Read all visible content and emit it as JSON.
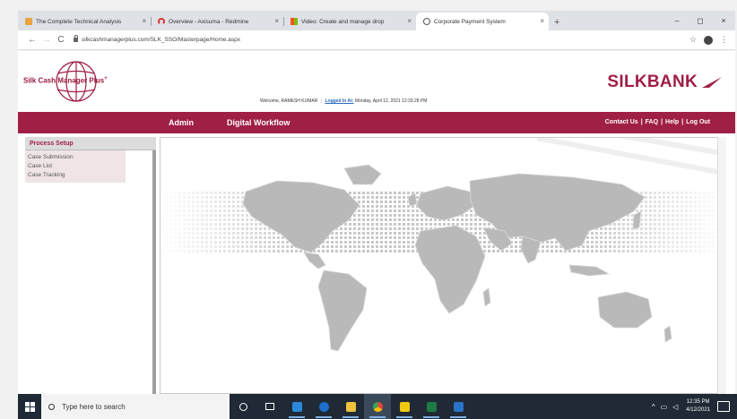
{
  "browser": {
    "tabs": [
      {
        "label": "The Complete Technical Analysis",
        "favicon": "pricepoint-icon",
        "active": false
      },
      {
        "label": "Overview - Axisuma - Redmine",
        "favicon": "redmine-arc-icon",
        "active": false
      },
      {
        "label": "Video: Create and manage drop",
        "favicon": "microsoft-icon",
        "active": false
      },
      {
        "label": "Corporate Payment System",
        "favicon": "globe-icon",
        "active": true
      }
    ],
    "new_tab": "+",
    "tab_close": "×",
    "window_controls": {
      "minimize": "–",
      "maximize": "◻",
      "close": "×"
    },
    "nav": {
      "back": "←",
      "forward": "→",
      "reload": "C"
    },
    "url": "silkcashmanagerplus.com/SLK_SSO/Masterpage/Home.aspx",
    "star": "☆",
    "menu": "⋮"
  },
  "site": {
    "brand_name": "Silk Cash Manager Plus",
    "brand_sup": "+",
    "welcome_prefix": "Welcome, RAMESH KUMAR",
    "welcome_sep": "|",
    "logged_in_label": "Logged In At:",
    "logged_in_time": "Monday, April 12, 2021 12:33:28 PM",
    "bank_name": "SILKBANK",
    "colors": {
      "brand": "#a01f45",
      "link": "#2a6bbf"
    }
  },
  "nav": {
    "items": [
      "Admin",
      "Digital Workflow"
    ],
    "utility": [
      "Contact Us",
      "FAQ",
      "Help",
      "Log Out"
    ],
    "utility_sep": "|"
  },
  "sidebar": {
    "section_title": "Process Setup",
    "items": [
      "Case Submission",
      "Case List",
      "Case Tracking"
    ]
  },
  "taskbar": {
    "search_placeholder": "Type here to search",
    "time": "12:35 PM",
    "date": "4/12/2021",
    "tray_chevron": "^"
  }
}
